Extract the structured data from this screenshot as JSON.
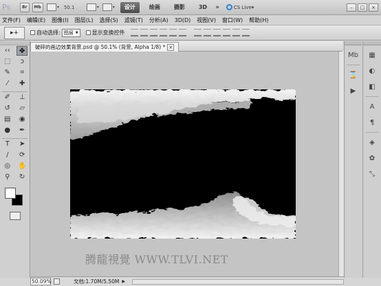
{
  "appbar": {
    "logo": "Ps",
    "bridge_label": "Br",
    "minibridge_label": "Mb",
    "zoom_value": "50.1",
    "workspaces": [
      "设计",
      "绘画",
      "摄影",
      "3D"
    ],
    "more_label": "»",
    "cslive_label": "CS Live",
    "icons": [
      "view-extras-icon",
      "arrange-documents-icon",
      "screen-mode-icon",
      "minimize-icon",
      "restore-icon",
      "close-icon"
    ]
  },
  "menu": {
    "items": [
      "文件(F)",
      "编辑(E)",
      "图像(I)",
      "图层(L)",
      "选择(S)",
      "滤镜(T)",
      "分析(A)",
      "3D(D)",
      "视图(V)",
      "窗口(W)",
      "帮助(H)"
    ]
  },
  "options": {
    "tool_preset": "▸+",
    "auto_select_label": "自动选择:",
    "auto_select_value": "图层",
    "show_transform_label": "显示变换控件"
  },
  "document": {
    "tab_title": "破碎的画边效果背景.psd @ 50.1% (背景, Alpha 1/8) *",
    "close_label": "×",
    "watermark": "腾龍視覺 WWW.TLVI.NET"
  },
  "status": {
    "zoom": "50.09%",
    "doc_info": "文档:1.70M/5.50M"
  },
  "colors": {
    "foreground": "#ffffff",
    "background": "#000000",
    "active_workspace": "#5a5a5a"
  }
}
